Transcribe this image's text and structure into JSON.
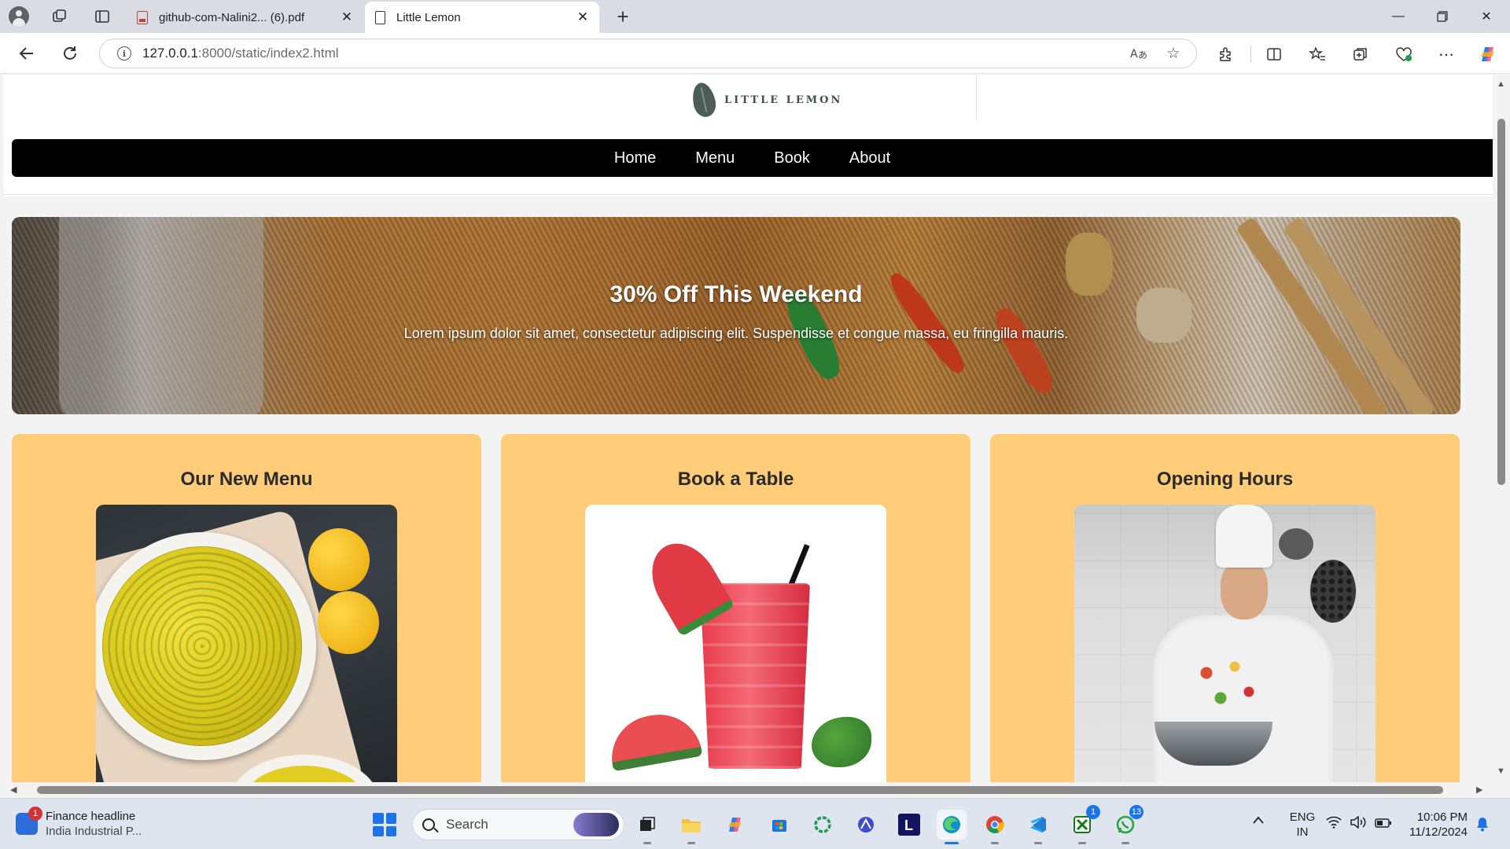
{
  "browser": {
    "tabs": [
      {
        "title": "github-com-Nalini2... (6).pdf",
        "type": "pdf"
      },
      {
        "title": "Little Lemon",
        "type": "page",
        "active": true
      }
    ],
    "url_host": "127.0.0.1",
    "url_rest": ":8000/static/index2.html"
  },
  "site": {
    "logo_text": "LITTLE LEMON",
    "nav": [
      "Home",
      "Menu",
      "Book",
      "About"
    ],
    "hero": {
      "title": "30% Off This Weekend",
      "text": "Lorem ipsum dolor sit amet, consectetur adipiscing elit. Suspendisse et congue massa, eu fringilla mauris."
    },
    "cards": [
      {
        "title": "Our New Menu",
        "image": "yellow-rice-bowl-with-lemons"
      },
      {
        "title": "Book a Table",
        "image": "watermelon-drink"
      },
      {
        "title": "Opening Hours",
        "image": "chef-tossing-wok"
      }
    ]
  },
  "taskbar": {
    "news_headline": "Finance headline",
    "news_sub": "India Industrial P...",
    "news_badge": "1",
    "search_placeholder": "Search",
    "badges": {
      "xbox": "1",
      "whatsapp": "13"
    },
    "lang_top": "ENG",
    "lang_bottom": "IN",
    "time": "10:06 PM",
    "date": "11/12/2024"
  },
  "colors": {
    "nav_bg": "#000000",
    "card_bg": "#ffcc7a",
    "logo_green": "#4a5e57"
  }
}
